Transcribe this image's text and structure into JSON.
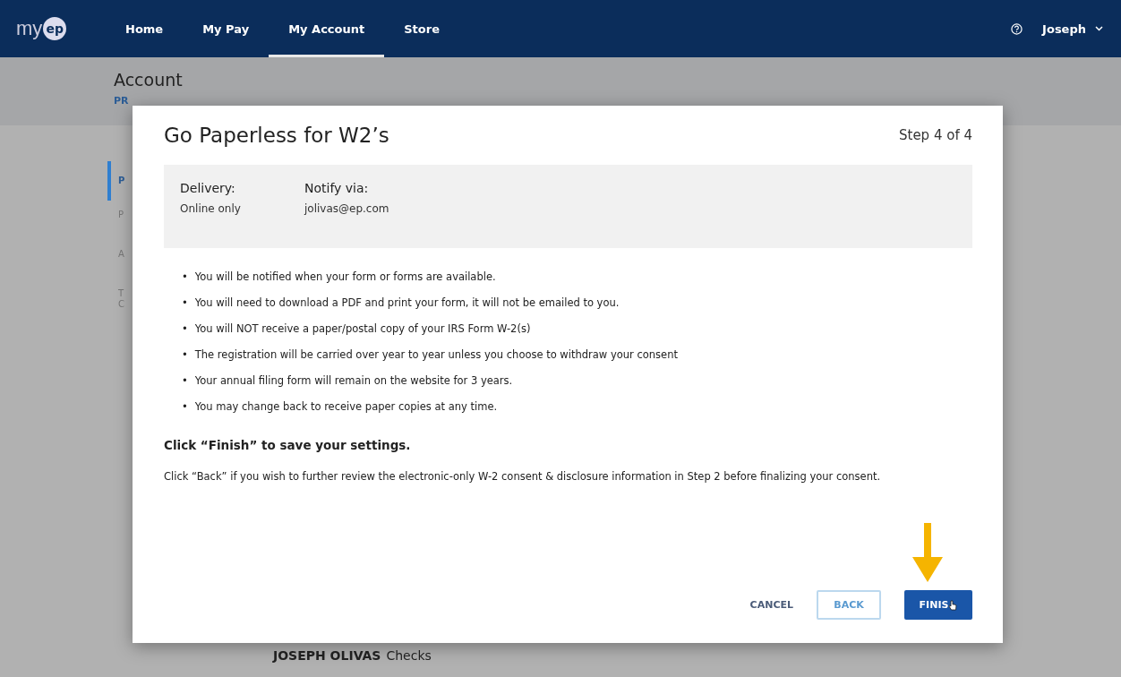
{
  "nav": {
    "logo_text": "my",
    "logo_badge": "ep",
    "items": [
      {
        "label": "Home",
        "selected": false
      },
      {
        "label": "My Pay",
        "selected": false
      },
      {
        "label": "My Account",
        "selected": true
      },
      {
        "label": "Store",
        "selected": false
      }
    ],
    "user": "Joseph"
  },
  "page": {
    "title": "Account",
    "tabs": [
      {
        "label": "PR",
        "selected": true
      }
    ],
    "sidebar": [
      {
        "lines": [
          "P"
        ],
        "selected": true
      },
      {
        "lines": [
          "P"
        ],
        "selected": false
      },
      {
        "lines": [
          "A"
        ],
        "selected": false
      },
      {
        "lines": [
          "T",
          "C"
        ],
        "selected": false
      }
    ],
    "footer_name": "JOSEPH OLIVAS",
    "footer_label": "Checks"
  },
  "dialog": {
    "title": "Go Paperless for W2’s",
    "step": "Step 4 of 4",
    "summary": [
      {
        "label": "Delivery:",
        "value": "Online only"
      },
      {
        "label": "Notify via:",
        "value": "jolivas@ep.com"
      }
    ],
    "bullet_marker": "•",
    "bullets": [
      "You will be notified when your form or forms are available.",
      "You will need to download a PDF and print your form, it will not be emailed to you.",
      "You will NOT receive a paper/postal copy of your IRS Form W-2(s)",
      "The registration will be carried over year to year unless you choose to withdraw your consent",
      "Your annual filing form will remain on the website for 3 years.",
      "You may change back to receive paper copies at any time."
    ],
    "instruction": "Click “Finish” to save your settings.",
    "note": "Click “Back” if you wish to further review the electronic-only W-2 consent & disclosure information in Step 2 before finalizing your consent.",
    "buttons": [
      {
        "label": "CANCEL",
        "kind": "text"
      },
      {
        "label": "BACK",
        "kind": "outline"
      },
      {
        "label": "FINIS",
        "kind": "primary"
      }
    ]
  }
}
